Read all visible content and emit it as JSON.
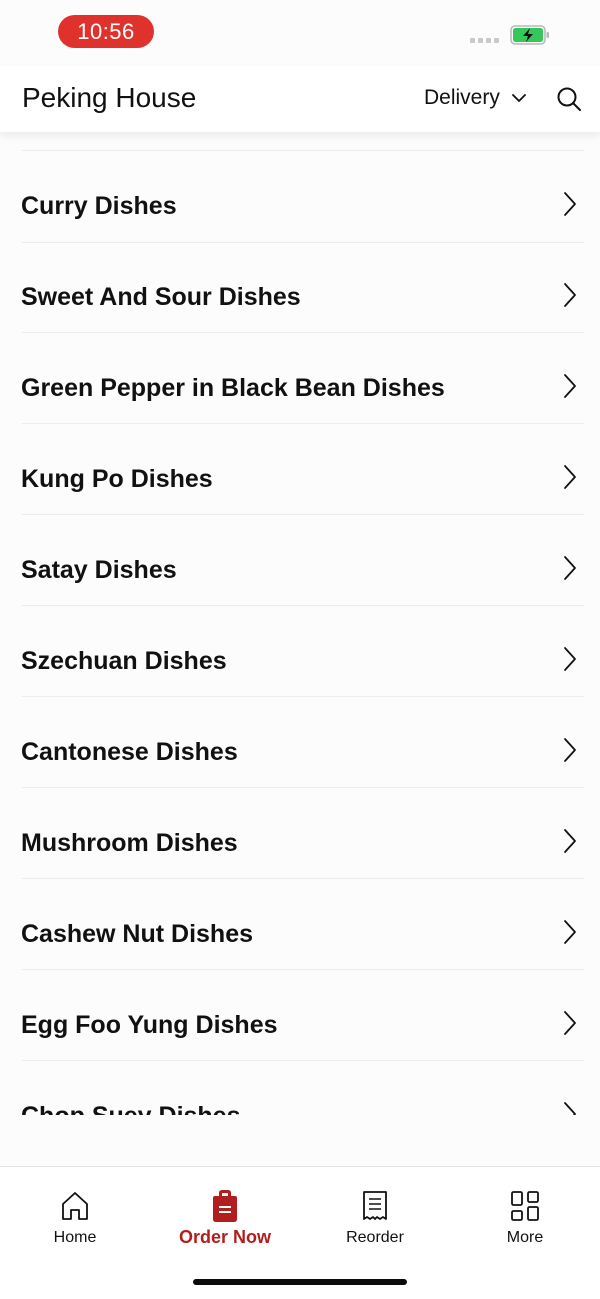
{
  "status_bar": {
    "time": "10:56"
  },
  "header": {
    "title": "Peking House",
    "delivery_label": "Delivery"
  },
  "menu": {
    "categories": [
      {
        "label": "Curry Dishes"
      },
      {
        "label": "Sweet And Sour Dishes"
      },
      {
        "label": "Green Pepper in Black Bean Dishes"
      },
      {
        "label": "Kung Po Dishes"
      },
      {
        "label": "Satay Dishes"
      },
      {
        "label": "Szechuan Dishes"
      },
      {
        "label": "Cantonese Dishes"
      },
      {
        "label": "Mushroom Dishes"
      },
      {
        "label": "Cashew Nut Dishes"
      },
      {
        "label": "Egg Foo Yung Dishes"
      },
      {
        "label": "Chop Suey Dishes"
      }
    ]
  },
  "tabbar": {
    "tabs": [
      {
        "label": "Home",
        "icon": "home-icon"
      },
      {
        "label": "Order Now",
        "icon": "order-bag-icon"
      },
      {
        "label": "Reorder",
        "icon": "receipt-icon"
      },
      {
        "label": "More",
        "icon": "grid-icon"
      }
    ],
    "active_index": 1
  },
  "colors": {
    "accent": "#b11e1e",
    "time_pill": "#e0322c",
    "battery": "#34c759"
  }
}
